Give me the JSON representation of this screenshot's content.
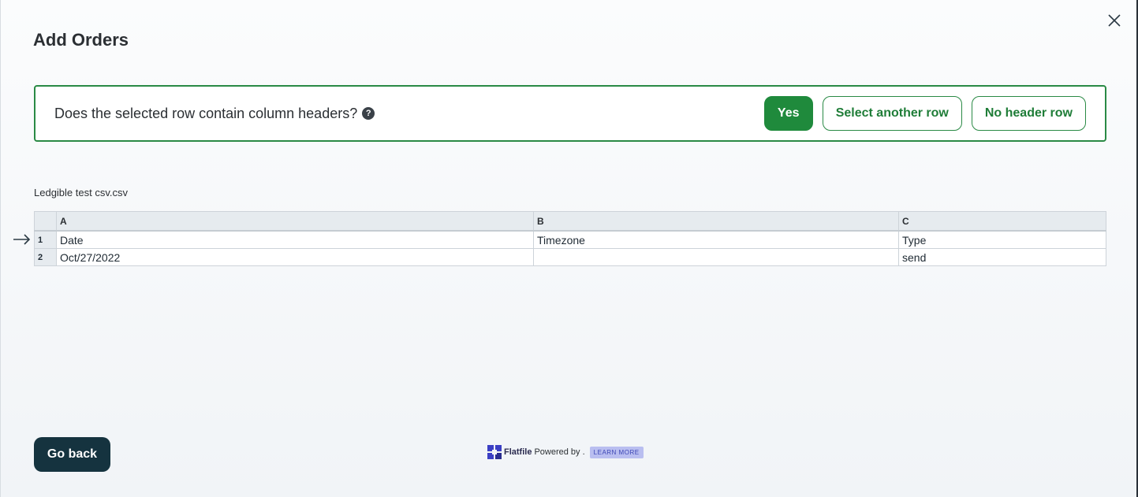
{
  "modal": {
    "title": "Add Orders",
    "close_icon": "close-icon"
  },
  "header_prompt": {
    "question": "Does the selected row contain column headers?",
    "help_icon": "?",
    "buttons": {
      "yes": "Yes",
      "select_another": "Select another row",
      "no_header": "No header row"
    }
  },
  "file": {
    "name": "Ledgible test csv.csv"
  },
  "grid": {
    "columns": [
      "A",
      "B",
      "C"
    ],
    "selected_row": 1,
    "rows": [
      {
        "num": "1",
        "cells": [
          "Date",
          "Timezone",
          "Type"
        ]
      },
      {
        "num": "2",
        "cells": [
          "Oct/27/2022",
          "",
          "send"
        ]
      }
    ]
  },
  "footer": {
    "go_back": "Go back",
    "brand_name": "Flatfile",
    "powered_by": "Powered by .",
    "learn_more": "LEARN MORE"
  },
  "colors": {
    "accent_green": "#1f8a3c",
    "dark_button": "#15333f",
    "learn_more_bg": "#b9bef0"
  }
}
